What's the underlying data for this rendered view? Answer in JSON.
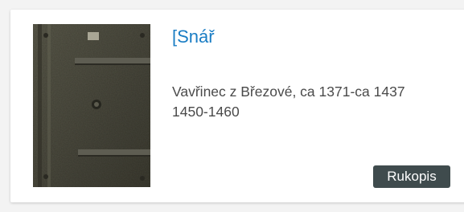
{
  "record": {
    "title": "[Snář",
    "author_line": "Vavřinec z Březové, ca 1371-ca 1437",
    "date_line": "1450-1460",
    "badge": "Rukopis",
    "badge_color": "#3f4b4d",
    "title_color": "#1a7dc4"
  },
  "cover": {
    "icon": "manuscript-cover-thumbnail"
  }
}
